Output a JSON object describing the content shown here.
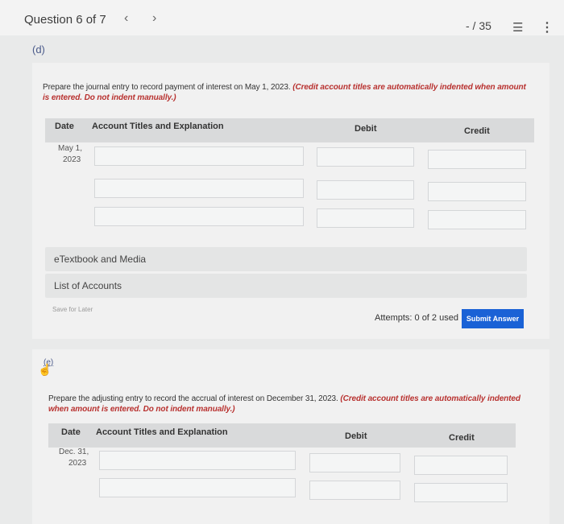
{
  "header": {
    "question": "Question 6 of 7",
    "prev_icon": "‹",
    "next_icon": "›",
    "score": "- / 35",
    "list_icon": "list-icon",
    "more_icon": "kebab-menu-icon"
  },
  "part_d": {
    "label": "(d)",
    "prompt_plain": "Prepare the journal entry to record payment of interest on May 1, 2023.",
    "prompt_note": "(Credit account titles are automatically indented when amount is entered. Do not indent manually.)",
    "table": {
      "col_date": "Date",
      "col_account": "Account Titles and Explanation",
      "col_debit": "Debit",
      "col_credit": "Credit",
      "date_line1": "May 1,",
      "date_line2": "2023"
    },
    "etextbook": "eTextbook and Media",
    "accounts": "List of Accounts",
    "save_later": "Save for Later",
    "attempts": "Attempts: 0 of 2 used",
    "submit": "Submit Answer"
  },
  "part_e": {
    "label": "(e)",
    "prompt_plain": "Prepare the adjusting entry to record the accrual of interest on December 31, 2023.",
    "prompt_note": "(Credit account titles are automatically indented when amount is entered. Do not indent manually.)",
    "table": {
      "col_date": "Date",
      "col_account": "Account Titles and Explanation",
      "col_debit": "Debit",
      "col_credit": "Credit",
      "date_line1": "Dec. 31,",
      "date_line2": "2023"
    }
  },
  "colors": {
    "accent": "#1a62d6",
    "note_red": "#b8312f",
    "panel_bg": "#f1f1f1",
    "header_bg": "#d9dadb"
  }
}
